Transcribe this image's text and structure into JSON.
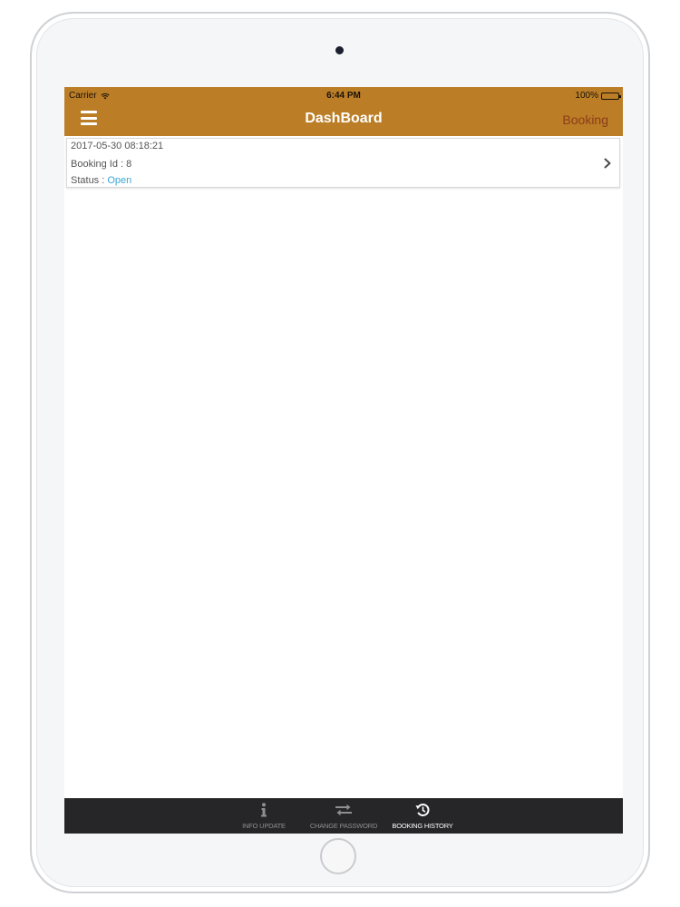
{
  "status_bar": {
    "carrier": "Carrier",
    "time": "6:44 PM",
    "battery": "100%"
  },
  "nav": {
    "title": "DashBoard",
    "right_button": "Booking",
    "menu_icon": "hamburger-menu-icon"
  },
  "bookings": [
    {
      "datetime": "2017-05-30 08:18:21",
      "id_label": "Booking Id : 8",
      "status_label": "Status : ",
      "status_value": "Open"
    }
  ],
  "tabs": [
    {
      "label": "INFO UPDATE",
      "icon": "info-icon",
      "active": false
    },
    {
      "label": "CHANGE PASSWORD",
      "icon": "swap-arrows-icon",
      "active": false
    },
    {
      "label": "BOOKING HISTORY",
      "icon": "history-icon",
      "active": true
    }
  ],
  "colors": {
    "nav_background": "#bb7e27",
    "nav_right_text": "#8a3d16",
    "status_open": "#3da7d8",
    "tab_bar_background": "#262628",
    "tab_inactive": "#8f8f92",
    "tab_active": "#ffffff"
  }
}
